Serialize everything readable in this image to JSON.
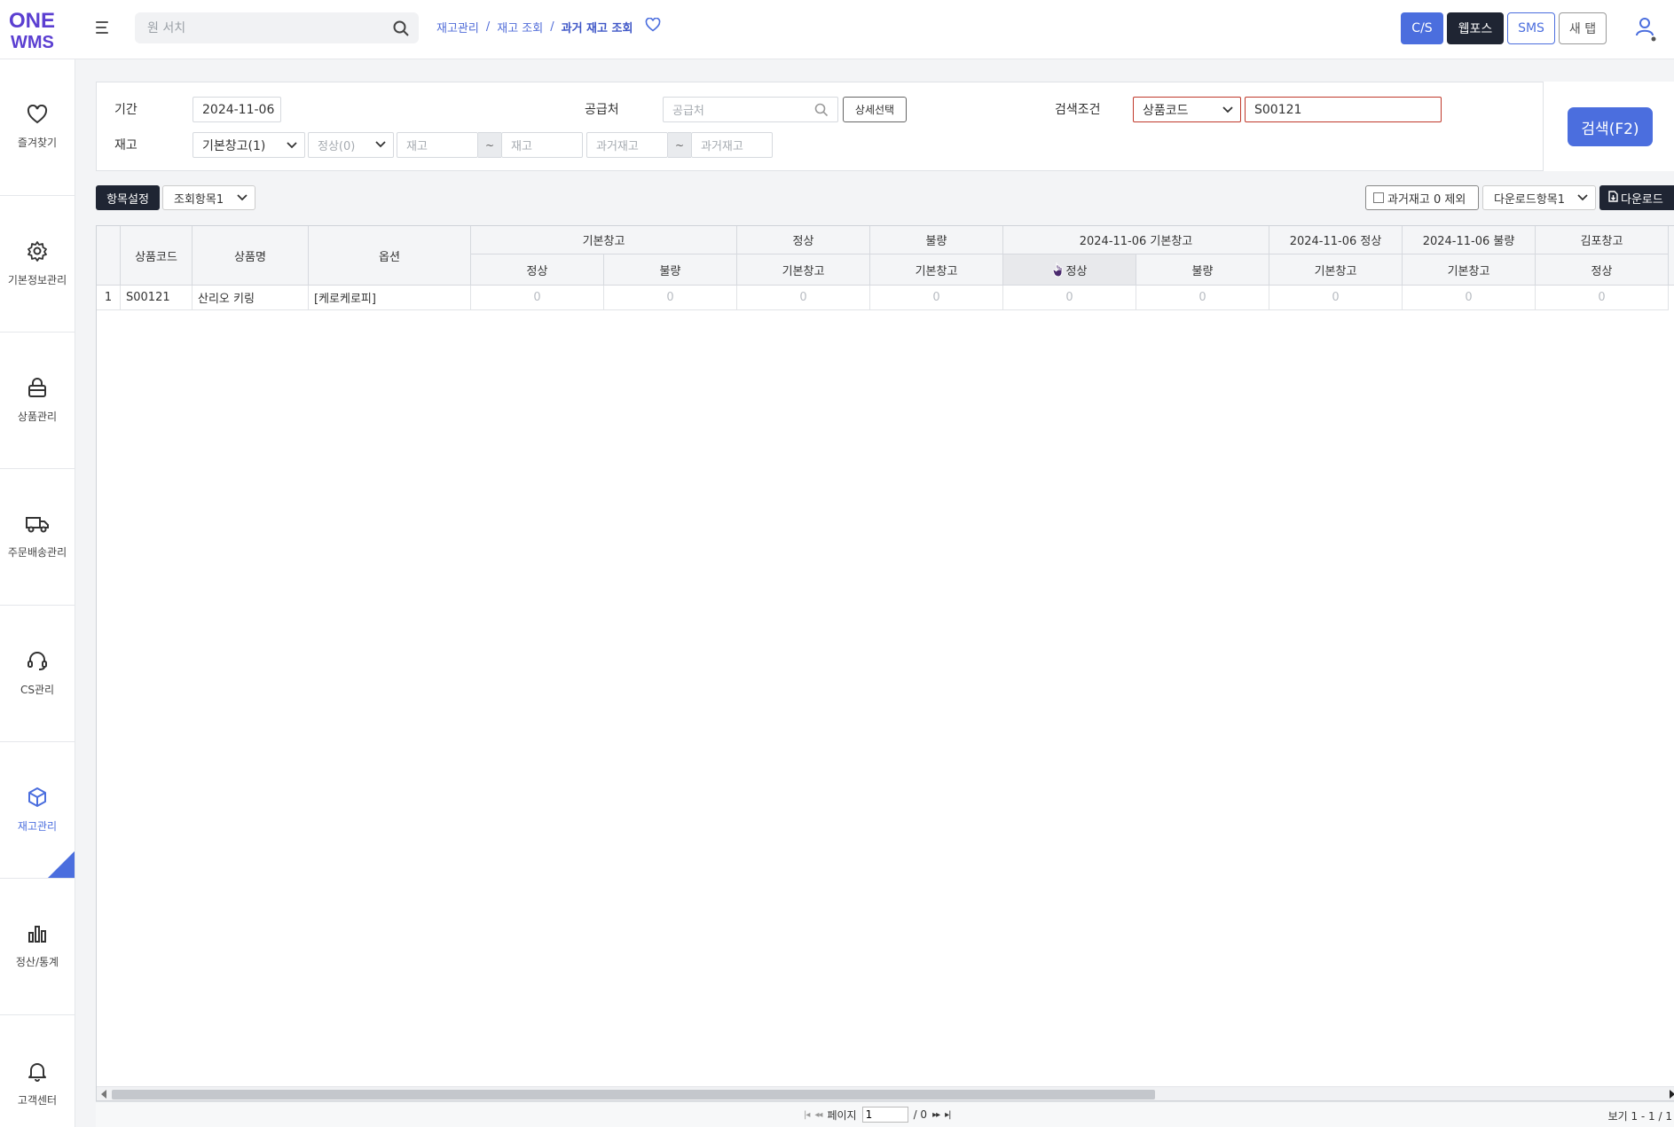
{
  "app": {
    "logo_line1": "ONE",
    "logo_line2": "WMS"
  },
  "header": {
    "search_placeholder": "원 서치",
    "breadcrumb": [
      "재고관리",
      "재고 조회",
      "과거 재고 조회"
    ],
    "buttons": {
      "cs": "C/S",
      "webpos": "웹포스",
      "sms": "SMS",
      "newtab": "새 탭"
    }
  },
  "sidebar": {
    "items": [
      {
        "label": "즐겨찾기",
        "icon": "heart-icon"
      },
      {
        "label": "기본정보관리",
        "icon": "gear-icon"
      },
      {
        "label": "상품관리",
        "icon": "lock-bag-icon"
      },
      {
        "label": "주문배송관리",
        "icon": "truck-icon"
      },
      {
        "label": "CS관리",
        "icon": "headset-icon"
      },
      {
        "label": "재고관리",
        "icon": "box-icon"
      },
      {
        "label": "정산/통계",
        "icon": "bar-chart-icon"
      },
      {
        "label": "고객센터",
        "icon": "bell-icon"
      }
    ]
  },
  "filter": {
    "period_label": "기간",
    "period_value": "2024-11-06",
    "supplier_label": "공급처",
    "supplier_placeholder": "공급처",
    "detail_select": "상세선택",
    "condition_label": "검색조건",
    "condition_type": "상품코드",
    "condition_value": "S00121",
    "stock_label": "재고",
    "warehouse_select": "기본창고(1)",
    "status_select": "정상(0)",
    "stock_from_placeholder": "재고",
    "stock_to_placeholder": "재고",
    "past_from_placeholder": "과거재고",
    "past_to_placeholder": "과거재고",
    "tilde": "~",
    "search_button": "검색(F2)"
  },
  "toolbar": {
    "column_settings": "항목설정",
    "view_items": "조회항목1",
    "exclude_zero": "과거재고 0 제외",
    "download_items": "다운로드항목1",
    "download": "다운로드"
  },
  "grid": {
    "fixed_headers": [
      "상품코드",
      "상품명",
      "옵션"
    ],
    "group_headers": [
      "기본창고",
      "정상",
      "불량",
      "2024-11-06 기본창고",
      "2024-11-06 정상",
      "2024-11-06 불량",
      "김포창고"
    ],
    "sub_headers": [
      "정상",
      "불량",
      "기본창고",
      "기본창고",
      "정상",
      "불량",
      "기본창고",
      "기본창고",
      "정상"
    ],
    "rows": [
      {
        "index": "1",
        "code": "S00121",
        "name": "산리오 키링",
        "option": "[케로케로피]",
        "values": [
          "0",
          "0",
          "0",
          "0",
          "0",
          "0",
          "0",
          "0",
          "0"
        ]
      }
    ]
  },
  "pager": {
    "page_label": "페이지",
    "page_value": "1",
    "page_total": "/ 0",
    "view_text": "보기 1 - 1 / 1"
  },
  "colors": {
    "primary": "#4b6ede",
    "dark": "#1f2533",
    "logo": "#5b3fd1"
  }
}
